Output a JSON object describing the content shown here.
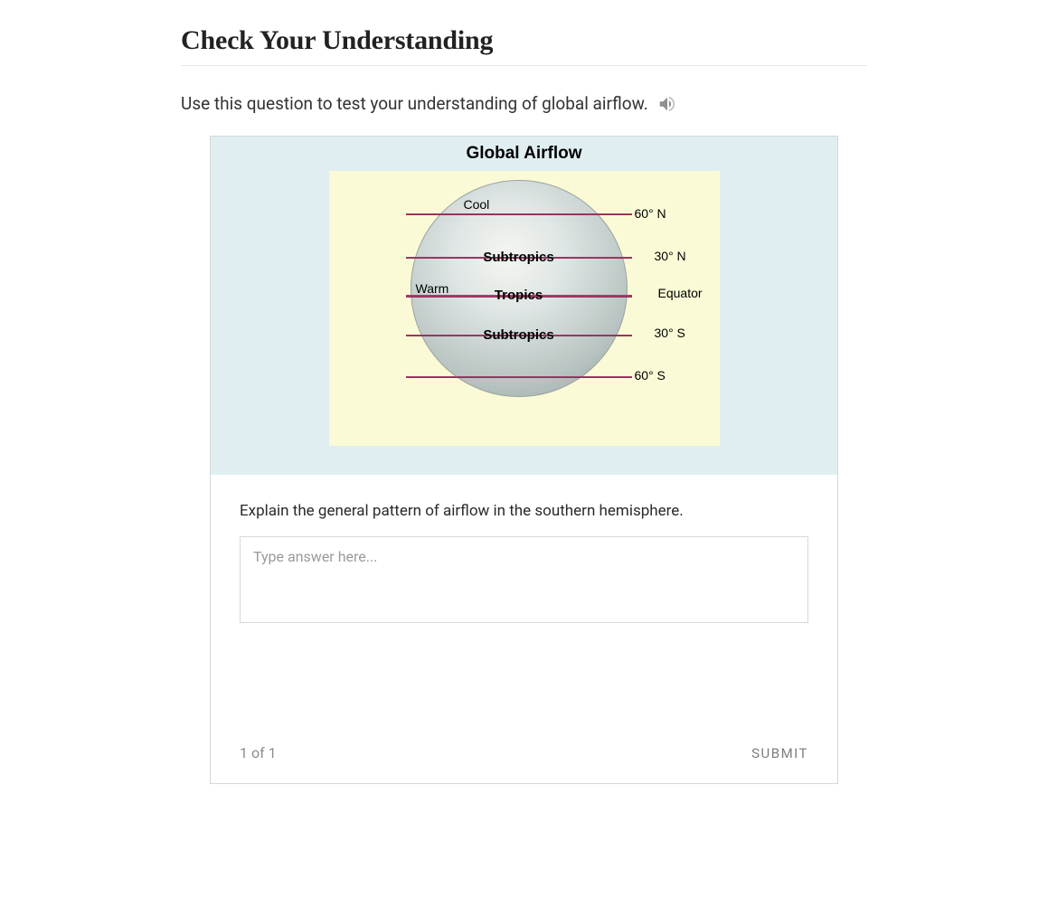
{
  "heading": "Check Your Understanding",
  "instructions": "Use this question to test your understanding of global airflow.",
  "icons": {
    "speaker": "speaker-icon"
  },
  "figure": {
    "title": "Global Airflow",
    "side_labels": {
      "warm": "Warm",
      "cool": "Cool"
    },
    "bands": {
      "subtropics_n": "Subtropics",
      "tropics": "Tropics",
      "subtropics_s": "Subtropics"
    },
    "latitudes": {
      "n60": "60° N",
      "n30": "30° N",
      "eq": "Equator",
      "s30": "30° S",
      "s60": "60° S"
    }
  },
  "question": "Explain the general pattern of airflow in the southern hemisphere.",
  "answer": {
    "value": "",
    "placeholder": "Type answer here..."
  },
  "pager": "1 of 1",
  "submit_label": "SUBMIT"
}
